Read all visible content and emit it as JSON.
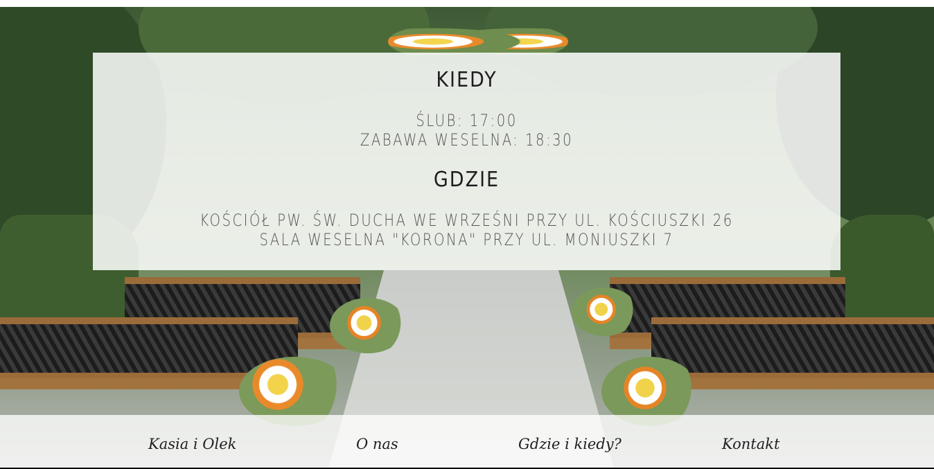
{
  "info": {
    "when_title": "KIEDY",
    "times": [
      "ŚLUB: 17:00",
      "ZABAWA WESELNA: 18:30"
    ],
    "where_title": "GDZIE",
    "places": [
      "KOŚCIÓŁ PW. ŚW. DUCHA WE WRZEŚNI PRZY UL. KOŚCIUSZKI 26",
      "SALA WESELNA \"KORONA\" PRZY UL. MONIUSZKI 7"
    ]
  },
  "nav": {
    "items": [
      "Kasia i Olek",
      "O nas",
      "Gdzie i kiedy?",
      "Kontakt"
    ]
  }
}
